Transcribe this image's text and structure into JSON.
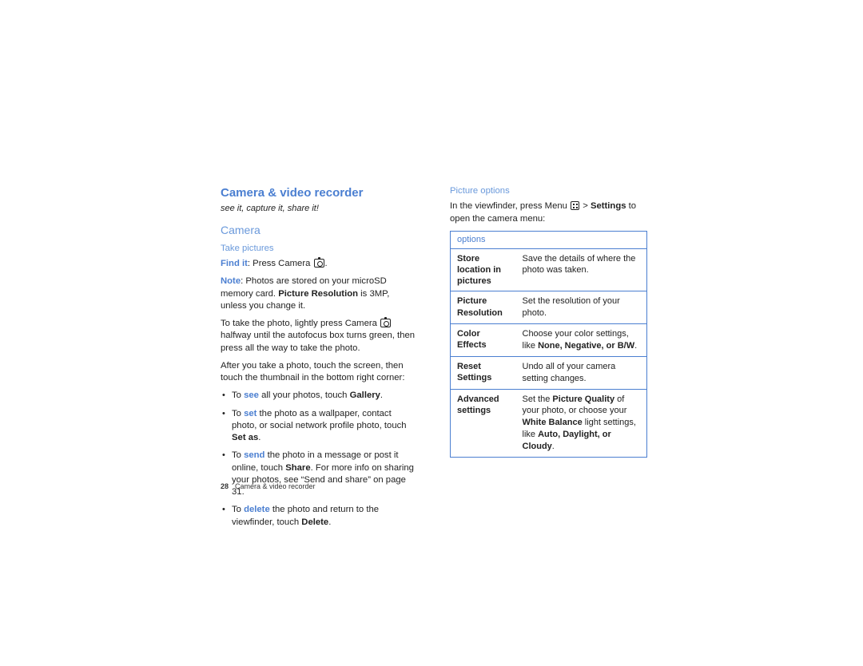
{
  "header": {
    "title": "Camera & video recorder",
    "tagline": "see it, capture it, share it!"
  },
  "section_camera": {
    "title": "Camera",
    "take_pictures_heading": "Take pictures",
    "findit_prefix": "Find it",
    "findit_text": ": Press Camera ",
    "note_prefix": "Note",
    "note_body_a": ": Photos are stored on your microSD memory card. ",
    "note_bold": "Picture Resolution",
    "note_body_b": " is 3MP, unless you change it.",
    "take_photo_a": "To take the photo, lightly press Camera ",
    "take_photo_b": " halfway until the autofocus box turns green, then press all the way to take the photo.",
    "after_photo": "After you take a photo, touch the screen, then touch the thumbnail in the bottom right corner:",
    "bullets": [
      {
        "pre": "To ",
        "w": "see",
        "mid": " all your photos, touch ",
        "b": "Gallery",
        "post": "."
      },
      {
        "pre": "To ",
        "w": "set",
        "mid": " the photo as a wallpaper, contact photo, or social network profile photo, touch ",
        "b": "Set as",
        "post": "."
      },
      {
        "pre": "To ",
        "w": "send",
        "mid": " the photo in a message or post it online, touch ",
        "b": "Share",
        "post": ". For more info on sharing your photos, see “Send and share” on page 31."
      },
      {
        "pre": "To ",
        "w": "delete",
        "mid": " the photo and return to the viewfinder, touch ",
        "b": "Delete",
        "post": "."
      }
    ]
  },
  "picture_options": {
    "heading": "Picture options",
    "intro_a": "In the viewfinder, press Menu ",
    "intro_b": " > ",
    "intro_settings": "Settings",
    "intro_c": " to open the camera menu:",
    "table_header": "options",
    "rows": [
      {
        "label": "Store location in pictures",
        "desc_a": "Save the details of where the photo was taken.",
        "desc_bold": "",
        "desc_b": ""
      },
      {
        "label": "Picture Resolution",
        "desc_a": "Set the resolution of your photo.",
        "desc_bold": "",
        "desc_b": ""
      },
      {
        "label": "Color Effects",
        "desc_a": "Choose your color settings, like ",
        "desc_bold": "None, Negative, or B/W",
        "desc_b": "."
      },
      {
        "label": "Reset Settings",
        "desc_a": "Undo all of your camera setting changes.",
        "desc_bold": "",
        "desc_b": ""
      },
      {
        "label": "Advanced settings",
        "desc_a": "Set the ",
        "desc_bold": "Picture Quality",
        "desc_b": " of your photo, or choose your ",
        "desc_bold2": "White Balance",
        "desc_b2": " light settings, like ",
        "desc_bold3": "Auto, Daylight, or Cloudy",
        "desc_b3": "."
      }
    ]
  },
  "footer": {
    "page_num": "28",
    "section": "Camera & video recorder"
  }
}
